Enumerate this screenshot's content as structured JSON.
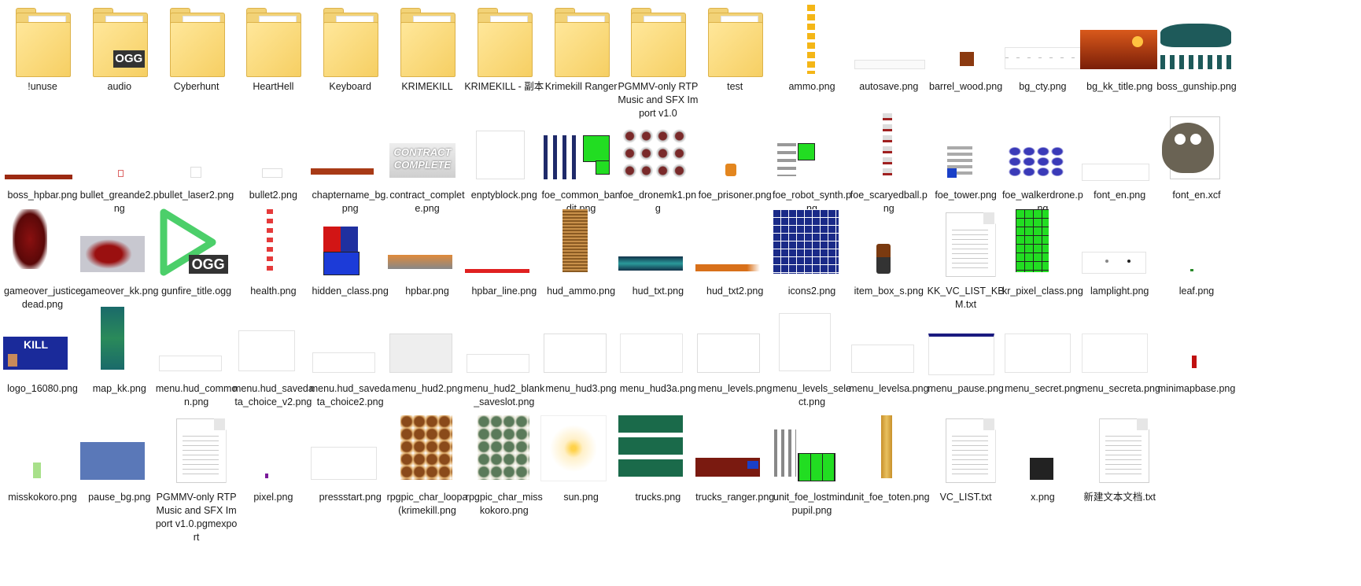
{
  "items": [
    {
      "name": "!unuse",
      "kind": "folder"
    },
    {
      "name": "audio",
      "kind": "folder"
    },
    {
      "name": "Cyberhunt",
      "kind": "folder"
    },
    {
      "name": "HeartHell",
      "kind": "folder"
    },
    {
      "name": "Keyboard",
      "kind": "folder"
    },
    {
      "name": "KRIMEKILL",
      "kind": "folder"
    },
    {
      "name": "KRIMEKILL - 副本",
      "kind": "folder"
    },
    {
      "name": "Krimekill Ranger",
      "kind": "folder"
    },
    {
      "name": "PGMMV-only RTP Music and SFX Import v1.0",
      "kind": "folder"
    },
    {
      "name": "test",
      "kind": "folder"
    },
    {
      "name": "ammo.png",
      "kind": "image"
    },
    {
      "name": "autosave.png",
      "kind": "image"
    },
    {
      "name": "barrel_wood.png",
      "kind": "image"
    },
    {
      "name": "bg_cty.png",
      "kind": "image"
    },
    {
      "name": "bg_kk_title.png",
      "kind": "image"
    },
    {
      "name": "boss_gunship.png",
      "kind": "image"
    },
    {
      "name": "boss_hpbar.png",
      "kind": "image"
    },
    {
      "name": "bullet_greande2.png",
      "kind": "image"
    },
    {
      "name": "bullet_laser2.png",
      "kind": "image"
    },
    {
      "name": "bullet2.png",
      "kind": "image"
    },
    {
      "name": "chaptername_bg.png",
      "kind": "image"
    },
    {
      "name": "contract_complete.png",
      "kind": "image"
    },
    {
      "name": "enptyblock.png",
      "kind": "image"
    },
    {
      "name": "foe_common_bandit.png",
      "kind": "image"
    },
    {
      "name": "foe_dronemk1.png",
      "kind": "image"
    },
    {
      "name": "foe_prisoner.png",
      "kind": "image"
    },
    {
      "name": "foe_robot_synth.png",
      "kind": "image"
    },
    {
      "name": "foe_scaryedball.png",
      "kind": "image"
    },
    {
      "name": "foe_tower.png",
      "kind": "image"
    },
    {
      "name": "foe_walkerdrone.png",
      "kind": "image"
    },
    {
      "name": "font_en.png",
      "kind": "image"
    },
    {
      "name": "font_en.xcf",
      "kind": "xcf"
    },
    {
      "name": "gameover_justicedead.png",
      "kind": "image"
    },
    {
      "name": "gameover_kk.png",
      "kind": "image"
    },
    {
      "name": "gunfire_title.ogg",
      "kind": "ogg"
    },
    {
      "name": "health.png",
      "kind": "image"
    },
    {
      "name": "hidden_class.png",
      "kind": "image"
    },
    {
      "name": "hpbar.png",
      "kind": "image"
    },
    {
      "name": "hpbar_line.png",
      "kind": "image"
    },
    {
      "name": "hud_ammo.png",
      "kind": "image"
    },
    {
      "name": "hud_txt.png",
      "kind": "image"
    },
    {
      "name": "hud_txt2.png",
      "kind": "image"
    },
    {
      "name": "icons2.png",
      "kind": "image"
    },
    {
      "name": "item_box_s.png",
      "kind": "image"
    },
    {
      "name": "KK_VC_LIST_KBM.txt",
      "kind": "txt"
    },
    {
      "name": "kr_pixel_class.png",
      "kind": "image"
    },
    {
      "name": "lamplight.png",
      "kind": "image"
    },
    {
      "name": "leaf.png",
      "kind": "image"
    },
    {
      "name": "logo_16080.png",
      "kind": "image",
      "overlay_text": "KILL"
    },
    {
      "name": "map_kk.png",
      "kind": "image"
    },
    {
      "name": "menu.hud_common.png",
      "kind": "image"
    },
    {
      "name": "menu.hud_savedata_choice_v2.png",
      "kind": "image"
    },
    {
      "name": "menu.hud_savedata_choice2.png",
      "kind": "image"
    },
    {
      "name": "menu_hud2.png",
      "kind": "image"
    },
    {
      "name": "menu_hud2_blank_saveslot.png",
      "kind": "image"
    },
    {
      "name": "menu_hud3.png",
      "kind": "image"
    },
    {
      "name": "menu_hud3a.png",
      "kind": "image"
    },
    {
      "name": "menu_levels.png",
      "kind": "image"
    },
    {
      "name": "menu_levels_select.png",
      "kind": "image"
    },
    {
      "name": "menu_levelsa.png",
      "kind": "image"
    },
    {
      "name": "menu_pause.png",
      "kind": "image"
    },
    {
      "name": "menu_secret.png",
      "kind": "image"
    },
    {
      "name": "menu_secreta.png",
      "kind": "image"
    },
    {
      "name": "minimapbase.png",
      "kind": "image"
    },
    {
      "name": "misskokoro.png",
      "kind": "image"
    },
    {
      "name": "pause_bg.png",
      "kind": "image"
    },
    {
      "name": "PGMMV-only RTP Music and SFX Import v1.0.pgmexport",
      "kind": "doc"
    },
    {
      "name": "pixel.png",
      "kind": "image"
    },
    {
      "name": "pressstart.png",
      "kind": "image"
    },
    {
      "name": "rpgpic_char_loopa(krimekill.png",
      "kind": "image"
    },
    {
      "name": "rpgpic_char_misskokoro.png",
      "kind": "image"
    },
    {
      "name": "sun.png",
      "kind": "image"
    },
    {
      "name": "trucks.png",
      "kind": "image"
    },
    {
      "name": "trucks_ranger.png",
      "kind": "image"
    },
    {
      "name": "unit_foe_lostmindpupil.png",
      "kind": "image"
    },
    {
      "name": "unit_foe_toten.png",
      "kind": "image"
    },
    {
      "name": "VC_LIST.txt",
      "kind": "txt"
    },
    {
      "name": "x.png",
      "kind": "image"
    },
    {
      "name": "新建文本文档.txt",
      "kind": "txt"
    }
  ],
  "badges": {
    "ogg": "OGG",
    "contract_line1": "CONTRACT",
    "contract_line2": "COMPLETE"
  }
}
